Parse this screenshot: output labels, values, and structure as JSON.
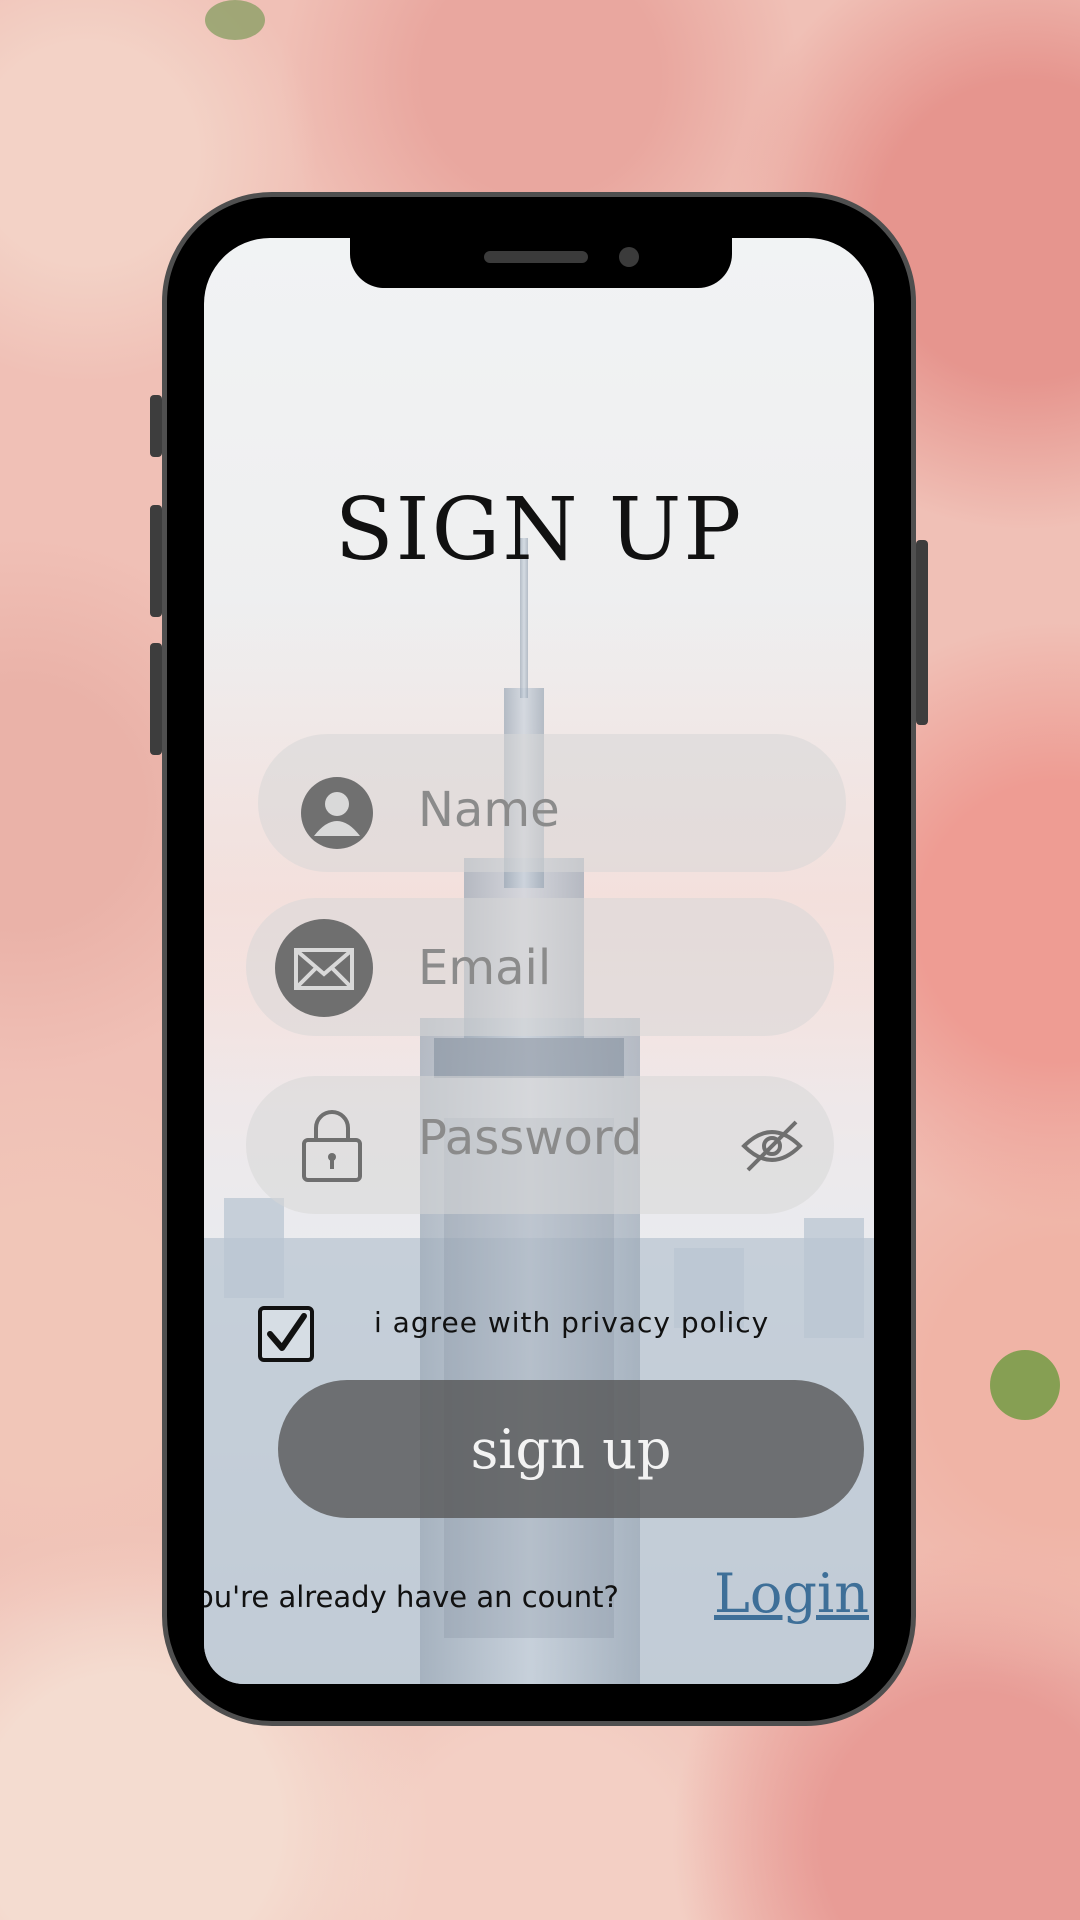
{
  "title": "SIGN UP",
  "fields": {
    "name_placeholder": "Name",
    "email_placeholder": "Email",
    "password_placeholder": "Password"
  },
  "agreement": {
    "label": "i agree with privacy policy",
    "checked": true
  },
  "signup_button_label": "sign up",
  "footer": {
    "prompt": "ou're already have an count?",
    "login_link": "Login"
  },
  "icons": [
    "user-icon",
    "mail-icon",
    "lock-icon",
    "eye-off-icon",
    "check-icon"
  ],
  "colors": {
    "title": "#111111",
    "field_background": "#d7d7d7",
    "placeholder": "#8b8b8b",
    "button": "#555555",
    "link": "#3e6f98"
  }
}
